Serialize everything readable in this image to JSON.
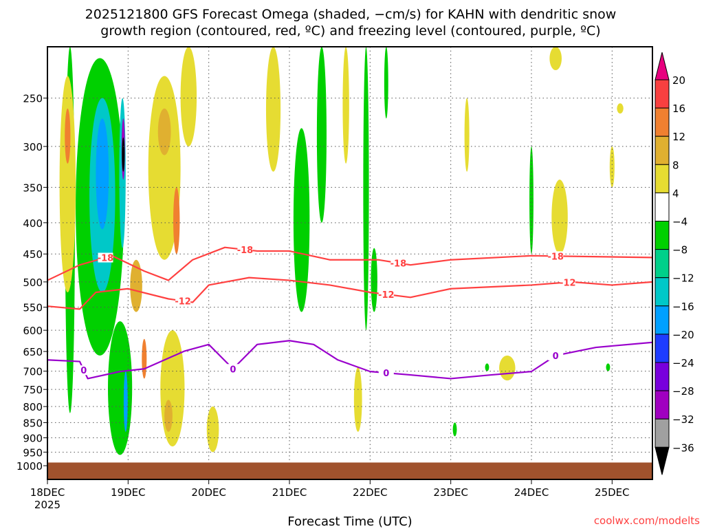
{
  "chart_data": {
    "type": "heatmap",
    "title_line1": "2025121800 GFS Forecast Omega (shaded, −cm/s) for KAHN with dendritic snow",
    "title_line2": "growth region (contoured, red, ºC) and freezing level (contoured, purple, ºC)",
    "xlabel": "Forecast Time (UTC)",
    "credit": "coolwx.com/modelts",
    "x_unit": "days since 2025-12-18 00Z",
    "xlim": [
      0,
      7.5
    ],
    "x_ticks": [
      {
        "day": 0,
        "label": "18DEC",
        "sublabel": "2025"
      },
      {
        "day": 1,
        "label": "19DEC"
      },
      {
        "day": 2,
        "label": "20DEC"
      },
      {
        "day": 3,
        "label": "21DEC"
      },
      {
        "day": 4,
        "label": "22DEC"
      },
      {
        "day": 5,
        "label": "23DEC"
      },
      {
        "day": 6,
        "label": "24DEC"
      },
      {
        "day": 7,
        "label": "25DEC"
      }
    ],
    "y_unit": "hPa",
    "y_scale": "log",
    "ylim": [
      206,
      1053
    ],
    "y_ticks": [
      250,
      300,
      350,
      400,
      450,
      500,
      550,
      600,
      650,
      700,
      750,
      800,
      850,
      900,
      950,
      1000
    ],
    "grid": true,
    "surface_pressure": 988,
    "surface_color": "#a0522d",
    "colorbar": {
      "levels": [
        "20",
        "16",
        "12",
        "8",
        "4",
        "−4",
        "−8",
        "−12",
        "−16",
        "−20",
        "−24",
        "−28",
        "−32",
        "−36"
      ],
      "over_color": "#e8007f",
      "under_color": "#000000",
      "colors": [
        "#f84040",
        "#f08030",
        "#e0b030",
        "#e6dc32",
        "#ffffff",
        "#00d000",
        "#00d08a",
        "#00c8c8",
        "#00a0ff",
        "#1e3cff",
        "#7800dc",
        "#a000c0",
        "#a0a0a0"
      ]
    },
    "omega_regions": [
      {
        "day": 0.28,
        "p_top": 206,
        "p_bot": 820,
        "w": 0.12,
        "value": -6
      },
      {
        "day": 0.65,
        "p_top": 215,
        "p_bot": 660,
        "w": 0.6,
        "value": -6
      },
      {
        "day": 0.68,
        "p_top": 250,
        "p_bot": 520,
        "w": 0.32,
        "value": -14
      },
      {
        "day": 0.68,
        "p_top": 270,
        "p_bot": 410,
        "w": 0.16,
        "value": -18
      },
      {
        "day": 0.93,
        "p_top": 250,
        "p_bot": 440,
        "w": 0.08,
        "value": -14
      },
      {
        "day": 0.94,
        "p_top": 270,
        "p_bot": 340,
        "w": 0.04,
        "value": -30
      },
      {
        "day": 0.94,
        "p_top": 290,
        "p_bot": 330,
        "w": 0.02,
        "value": -38
      },
      {
        "day": 0.9,
        "p_top": 580,
        "p_bot": 960,
        "w": 0.3,
        "value": -6
      },
      {
        "day": 0.97,
        "p_top": 700,
        "p_bot": 880,
        "w": 0.05,
        "value": -18
      },
      {
        "day": 0.25,
        "p_top": 230,
        "p_bot": 520,
        "w": 0.2,
        "value": 6
      },
      {
        "day": 0.25,
        "p_top": 260,
        "p_bot": 320,
        "w": 0.07,
        "value": 14
      },
      {
        "day": 1.45,
        "p_top": 230,
        "p_bot": 460,
        "w": 0.4,
        "value": 6
      },
      {
        "day": 1.45,
        "p_top": 260,
        "p_bot": 310,
        "w": 0.16,
        "value": 10
      },
      {
        "day": 1.6,
        "p_top": 350,
        "p_bot": 450,
        "w": 0.08,
        "value": 14
      },
      {
        "day": 1.75,
        "p_top": 206,
        "p_bot": 300,
        "w": 0.2,
        "value": 6
      },
      {
        "day": 1.1,
        "p_top": 460,
        "p_bot": 560,
        "w": 0.15,
        "value": 10
      },
      {
        "day": 1.2,
        "p_top": 620,
        "p_bot": 720,
        "w": 0.06,
        "value": 14
      },
      {
        "day": 1.55,
        "p_top": 600,
        "p_bot": 930,
        "w": 0.3,
        "value": 6
      },
      {
        "day": 1.5,
        "p_top": 780,
        "p_bot": 880,
        "w": 0.1,
        "value": 10
      },
      {
        "day": 2.05,
        "p_top": 800,
        "p_bot": 950,
        "w": 0.15,
        "value": 6
      },
      {
        "day": 2.8,
        "p_top": 206,
        "p_bot": 330,
        "w": 0.18,
        "value": 6
      },
      {
        "day": 3.15,
        "p_top": 280,
        "p_bot": 560,
        "w": 0.2,
        "value": -6
      },
      {
        "day": 3.4,
        "p_top": 206,
        "p_bot": 400,
        "w": 0.12,
        "value": -6
      },
      {
        "day": 3.7,
        "p_top": 206,
        "p_bot": 320,
        "w": 0.08,
        "value": 6
      },
      {
        "day": 3.95,
        "p_top": 206,
        "p_bot": 600,
        "w": 0.07,
        "value": -6
      },
      {
        "day": 4.05,
        "p_top": 440,
        "p_bot": 560,
        "w": 0.08,
        "value": -6
      },
      {
        "day": 3.85,
        "p_top": 690,
        "p_bot": 880,
        "w": 0.1,
        "value": 6
      },
      {
        "day": 4.2,
        "p_top": 206,
        "p_bot": 270,
        "w": 0.05,
        "value": -6
      },
      {
        "day": 5.2,
        "p_top": 250,
        "p_bot": 330,
        "w": 0.06,
        "value": 6
      },
      {
        "day": 6.0,
        "p_top": 300,
        "p_bot": 450,
        "w": 0.05,
        "value": -6
      },
      {
        "day": 6.35,
        "p_top": 340,
        "p_bot": 450,
        "w": 0.2,
        "value": 6
      },
      {
        "day": 6.3,
        "p_top": 206,
        "p_bot": 225,
        "w": 0.15,
        "value": 6
      },
      {
        "day": 7.0,
        "p_top": 300,
        "p_bot": 350,
        "w": 0.06,
        "value": 6
      },
      {
        "day": 5.7,
        "p_top": 660,
        "p_bot": 725,
        "w": 0.2,
        "value": 6
      },
      {
        "day": 5.05,
        "p_top": 850,
        "p_bot": 895,
        "w": 0.05,
        "value": -6
      },
      {
        "day": 5.45,
        "p_top": 680,
        "p_bot": 700,
        "w": 0.05,
        "value": -6
      },
      {
        "day": 6.95,
        "p_top": 680,
        "p_bot": 700,
        "w": 0.05,
        "value": -6
      },
      {
        "day": 7.1,
        "p_top": 255,
        "p_bot": 265,
        "w": 0.08,
        "value": 6
      }
    ],
    "contours": [
      {
        "name": "dgz-top",
        "value": -18,
        "color": "#ff4040",
        "label": "-18",
        "points": [
          [
            0,
            497
          ],
          [
            0.4,
            469
          ],
          [
            0.8,
            453
          ],
          [
            1.2,
            480
          ],
          [
            1.5,
            497
          ],
          [
            1.8,
            460
          ],
          [
            2.2,
            439
          ],
          [
            2.6,
            445
          ],
          [
            3.0,
            445
          ],
          [
            3.5,
            460
          ],
          [
            4.1,
            460
          ],
          [
            4.5,
            469
          ],
          [
            5.0,
            460
          ],
          [
            6.0,
            453
          ],
          [
            7.5,
            456
          ]
        ],
        "label_days": [
          0.72,
          2.45,
          4.35,
          6.3
        ]
      },
      {
        "name": "dgz-bottom",
        "value": -12,
        "color": "#ff4040",
        "label": "-12",
        "points": [
          [
            0,
            548
          ],
          [
            0.4,
            554
          ],
          [
            0.6,
            520
          ],
          [
            1.0,
            513
          ],
          [
            1.5,
            533
          ],
          [
            1.8,
            540
          ],
          [
            2.0,
            506
          ],
          [
            2.5,
            492
          ],
          [
            3.0,
            497
          ],
          [
            3.5,
            506
          ],
          [
            4.0,
            520
          ],
          [
            4.5,
            530
          ],
          [
            5.0,
            513
          ],
          [
            6.0,
            506
          ],
          [
            6.5,
            500
          ],
          [
            7.0,
            506
          ],
          [
            7.5,
            500
          ]
        ],
        "label_days": [
          1.68,
          4.2,
          6.45
        ]
      },
      {
        "name": "freezing-level",
        "value": 0,
        "color": "#9900cc",
        "label": "0",
        "points": [
          [
            0,
            671
          ],
          [
            0.4,
            675
          ],
          [
            0.5,
            720
          ],
          [
            0.9,
            701
          ],
          [
            1.2,
            694
          ],
          [
            1.7,
            649
          ],
          [
            2.0,
            633
          ],
          [
            2.3,
            694
          ],
          [
            2.6,
            633
          ],
          [
            3.0,
            624
          ],
          [
            3.3,
            633
          ],
          [
            3.6,
            671
          ],
          [
            4.0,
            701
          ],
          [
            4.5,
            710
          ],
          [
            5.0,
            720
          ],
          [
            5.5,
            710
          ],
          [
            6.0,
            701
          ],
          [
            6.3,
            660
          ],
          [
            6.8,
            640
          ],
          [
            7.5,
            628
          ]
        ],
        "label_days": [
          0.45,
          2.3,
          4.2,
          6.3
        ]
      }
    ]
  }
}
